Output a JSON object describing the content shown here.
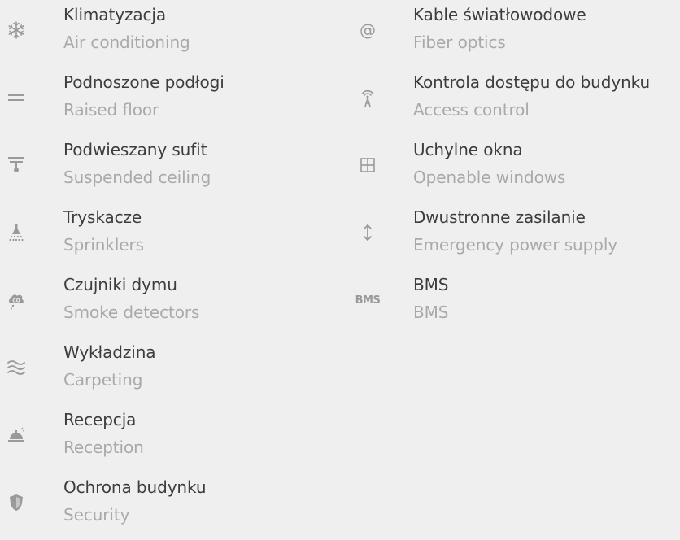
{
  "amenities_left": [
    {
      "pl": "Klimatyzacja",
      "en": "Air conditioning",
      "icon": "snowflake-icon"
    },
    {
      "pl": "Podnoszone podłogi",
      "en": "Raised floor",
      "icon": "raised-floor-icon"
    },
    {
      "pl": "Podwieszany sufit",
      "en": "Suspended ceiling",
      "icon": "suspended-ceiling-icon"
    },
    {
      "pl": "Tryskacze",
      "en": "Sprinklers",
      "icon": "sprinkler-icon"
    },
    {
      "pl": "Czujniki dymu",
      "en": "Smoke detectors",
      "icon": "smoke-detector-icon"
    },
    {
      "pl": "Wykładzina",
      "en": "Carpeting",
      "icon": "carpet-waves-icon"
    },
    {
      "pl": "Recepcja",
      "en": "Reception",
      "icon": "reception-bell-icon"
    },
    {
      "pl": "Ochrona budynku",
      "en": "Security",
      "icon": "shield-icon"
    }
  ],
  "amenities_right": [
    {
      "pl": "Kable światłowodowe",
      "en": "Fiber optics",
      "icon": "at-sign-icon"
    },
    {
      "pl": "Kontrola dostępu do budynku",
      "en": "Access control",
      "icon": "antenna-icon"
    },
    {
      "pl": "Uchylne okna",
      "en": "Openable windows",
      "icon": "window-icon"
    },
    {
      "pl": "Dwustronne zasilanie",
      "en": "Emergency power supply",
      "icon": "up-down-arrow-icon"
    },
    {
      "pl": "BMS",
      "en": "BMS",
      "icon": "bms-icon",
      "icon_text": "BMS"
    }
  ],
  "colors": {
    "background": "#efefef",
    "primary_text": "#3d3d3d",
    "secondary_text": "#a9a9a9",
    "icon": "#9a9a9a"
  }
}
